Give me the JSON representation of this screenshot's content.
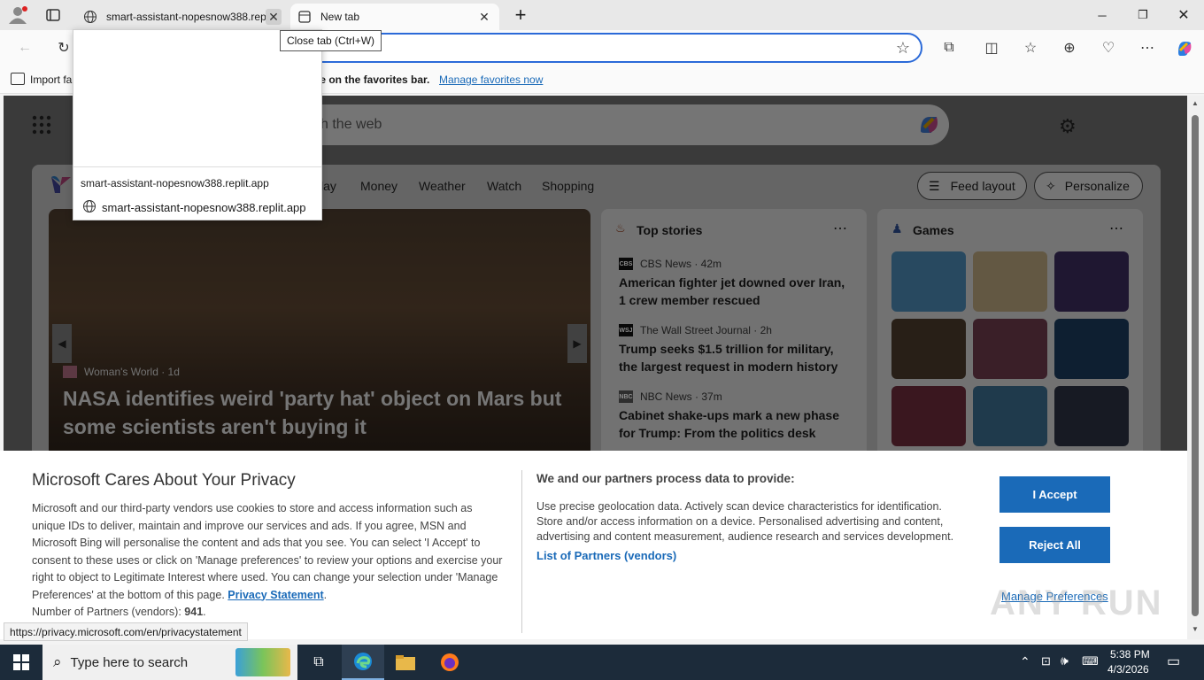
{
  "tabs": [
    {
      "label": "smart-assistant-nopesnow388.replit.app",
      "active": false
    },
    {
      "label": "New tab",
      "active": true
    }
  ],
  "toolbar": {
    "new_tab": "+"
  },
  "favbar": {
    "import_label": "Import fa",
    "message": "ere on the favorites bar.",
    "manage_link": "Manage favorites now"
  },
  "page": {
    "search_placeholder": "h the web",
    "nav": [
      "lay",
      "Money",
      "Weather",
      "Watch",
      "Shopping"
    ],
    "feed_layout": "Feed layout",
    "personalize": "Personalize",
    "hero": {
      "source": "Woman's World · 1d",
      "headline": "NASA identifies weird 'party hat' object on Mars but some scientists aren't buying it"
    },
    "top_stories": {
      "title": "Top stories",
      "items": [
        {
          "logo": "CBS",
          "source": "CBS News · 42m",
          "title": "American fighter jet downed over Iran, 1 crew member rescued"
        },
        {
          "logo": "WSJ",
          "source": "The Wall Street Journal · 2h",
          "title": "Trump seeks $1.5 trillion for military, the largest request in modern history"
        },
        {
          "logo": "NBC",
          "source": "NBC News · 37m",
          "title": "Cabinet shake-ups mark a new phase for Trump: From the politics desk"
        }
      ]
    },
    "games": {
      "title": "Games"
    }
  },
  "privacy": {
    "heading": "Microsoft Cares About Your Privacy",
    "body": "Microsoft and our third-party vendors use cookies to store and access information such as unique IDs to deliver, maintain and improve our services and ads. If you agree, MSN and Microsoft Bing will personalise the content and ads that you see. You can select 'I Accept' to consent to these uses or click on 'Manage preferences' to review your options and exercise your right to object to Legitimate Interest where used.  You can change your selection under 'Manage Preferences' at the bottom of this page.",
    "privacy_link": "Privacy Statement",
    "partners_label": "Number of Partners (vendors):",
    "partners_count": "941",
    "right_heading": "We and our partners process data to provide:",
    "right_body": "Use precise geolocation data. Actively scan device characteristics for identification. Store and/or access information on a device. Personalised advertising and content, advertising and content measurement, audience research and services development.",
    "partners_link": "List of Partners (vendors)",
    "accept": "I Accept",
    "reject": "Reject All",
    "manage": "Manage Preferences"
  },
  "hovercard": {
    "title": "smart-assistant-nopesnow388.replit.app",
    "url": "smart-assistant-nopesnow388.replit.app"
  },
  "tooltip": "Close tab (Ctrl+W)",
  "status_url": "https://privacy.microsoft.com/en/privacystatement",
  "watermark": "ANY RUN",
  "taskbar": {
    "search_placeholder": "Type here to search",
    "time": "5:38 PM",
    "date": "4/3/2026"
  }
}
